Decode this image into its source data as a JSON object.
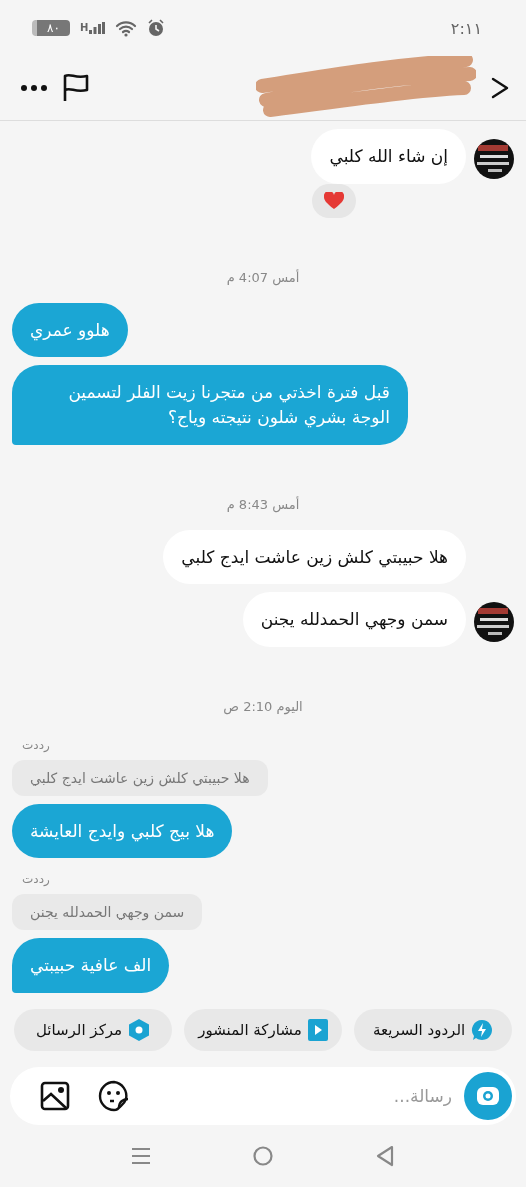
{
  "status_bar": {
    "time": "٢:١١",
    "battery": "٨٠",
    "network": "H"
  },
  "header": {
    "redacted": true
  },
  "messages": [
    {
      "kind": "received",
      "text": "إن شاء الله كلبي",
      "avatar": true,
      "reacted": true
    },
    {
      "kind": "time",
      "text": "أمس 4:07 م"
    },
    {
      "kind": "sent",
      "text": "هلوو عمري",
      "tail": false
    },
    {
      "kind": "sent",
      "text": "قبل فترة اخذتي من متجرنا زيت الفلر لتسمين الوجة بشري شلون نتيجته وياج؟",
      "tail": true
    },
    {
      "kind": "time",
      "text": "أمس 8:43 م"
    },
    {
      "kind": "received",
      "text": "هلا حبيبتي كلش زين عاشت ايدج كلبي",
      "avatar": false,
      "reacted": false
    },
    {
      "kind": "received",
      "text": "سمن وجهي الحمدلله يجنن",
      "avatar": true,
      "reacted": false
    },
    {
      "kind": "time",
      "text": "اليوم 2:10 ص"
    },
    {
      "kind": "reply",
      "label": "رددت",
      "quote": "هلا حبيبتي كلش زين عاشت ايدج كلبي",
      "text": "هلا بيج كلبي وايدج العايشة",
      "tail": false
    },
    {
      "kind": "reply",
      "label": "رددت",
      "quote": "سمن وجهي الحمدلله يجنن",
      "text": "الف عافية حبيبتي",
      "tail": true
    }
  ],
  "quick_actions": [
    {
      "kind": "bolt",
      "label": "الردود السريعة"
    },
    {
      "kind": "play",
      "label": "مشاركة المنشور"
    },
    {
      "kind": "hexagon",
      "label": "مركز الرسائل"
    }
  ],
  "composer": {
    "placeholder": "رسالة..."
  }
}
